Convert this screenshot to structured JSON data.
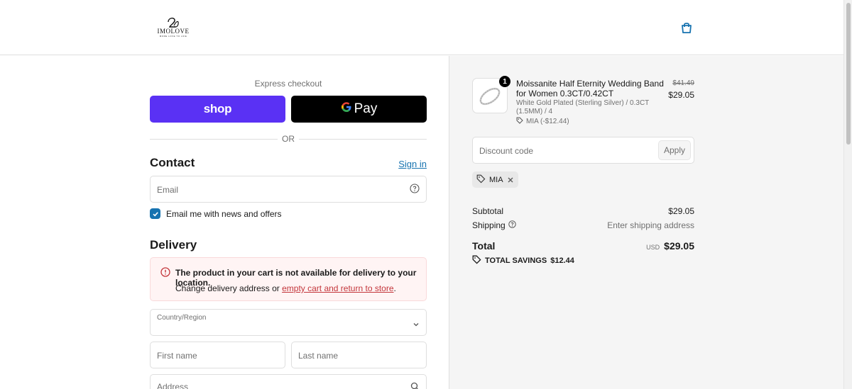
{
  "header": {
    "brand": "IMOLOVE",
    "tagline": "MORE LOVE TO LIFE",
    "cart_icon": "shopping-bag-icon"
  },
  "express": {
    "title": "Express checkout",
    "shop_label": "shop",
    "gpay_g": "G",
    "gpay_label": "Pay",
    "or_label": "OR"
  },
  "contact": {
    "title": "Contact",
    "signin_label": "Sign in",
    "email_placeholder": "Email",
    "newsletter_label": "Email me with news and offers",
    "newsletter_checked": true
  },
  "delivery": {
    "title": "Delivery",
    "alert_title": "The product in your cart is not available for delivery to your location.",
    "alert_text": "Change delivery address or",
    "alert_link": "empty cart and return to store",
    "alert_end": ".",
    "country_label": "Country/Region",
    "first_name_placeholder": "First name",
    "last_name_placeholder": "Last name",
    "address_placeholder": "Address"
  },
  "summary": {
    "item": {
      "quantity": "1",
      "name": "Moissanite Half Eternity Wedding Band for Women 0.3CT/0.42CT",
      "variant": "White Gold Plated (Sterling Silver) / 0.3CT (1.5MM) / 4",
      "discount": "MIA (-$12.44)",
      "price_original": "$41.49",
      "price_final": "$29.05"
    },
    "discount_placeholder": "Discount code",
    "apply_label": "Apply",
    "applied_code": "MIA",
    "subtotal_label": "Subtotal",
    "subtotal_value": "$29.05",
    "shipping_label": "Shipping",
    "shipping_value": "Enter shipping address",
    "total_label": "Total",
    "total_currency": "USD",
    "total_value": "$29.05",
    "savings_label": "TOTAL SAVINGS",
    "savings_value": "$12.44"
  },
  "colors": {
    "shop_purple": "#5a31f4",
    "link_blue": "#1773b0",
    "error_red": "#c3353a"
  }
}
